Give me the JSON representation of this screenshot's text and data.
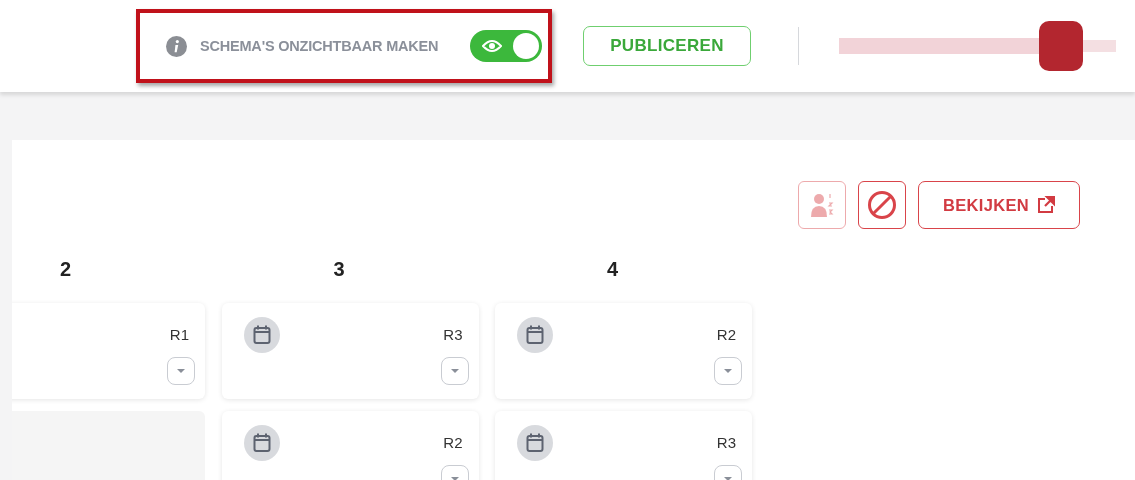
{
  "header": {
    "highlighted": true,
    "hide_label": "SCHEMA'S ONZICHTBAAR MAKEN",
    "hide_toggle": {
      "on": true
    },
    "publish_button": "PUBLICEREN",
    "user": {
      "redacted": true
    }
  },
  "toolbar": {
    "buttons": [
      {
        "kind": "person-list",
        "disabled": true
      },
      {
        "kind": "block",
        "disabled": false
      }
    ],
    "view_button": "BEKIJKEN"
  },
  "columns": [
    {
      "heading": "2",
      "cards": [
        {
          "kind": "entry",
          "round": "R1",
          "menu": true
        },
        {
          "kind": "empty"
        }
      ]
    },
    {
      "heading": "3",
      "cards": [
        {
          "kind": "entry",
          "calendar": true,
          "round": "R3",
          "menu": true
        },
        {
          "kind": "entry",
          "calendar": true,
          "round": "R2",
          "menu": true
        }
      ]
    },
    {
      "heading": "4",
      "cards": [
        {
          "kind": "entry",
          "calendar": true,
          "round": "R2",
          "menu": true
        },
        {
          "kind": "entry",
          "calendar": true,
          "round": "R3",
          "menu": true
        }
      ]
    }
  ]
}
